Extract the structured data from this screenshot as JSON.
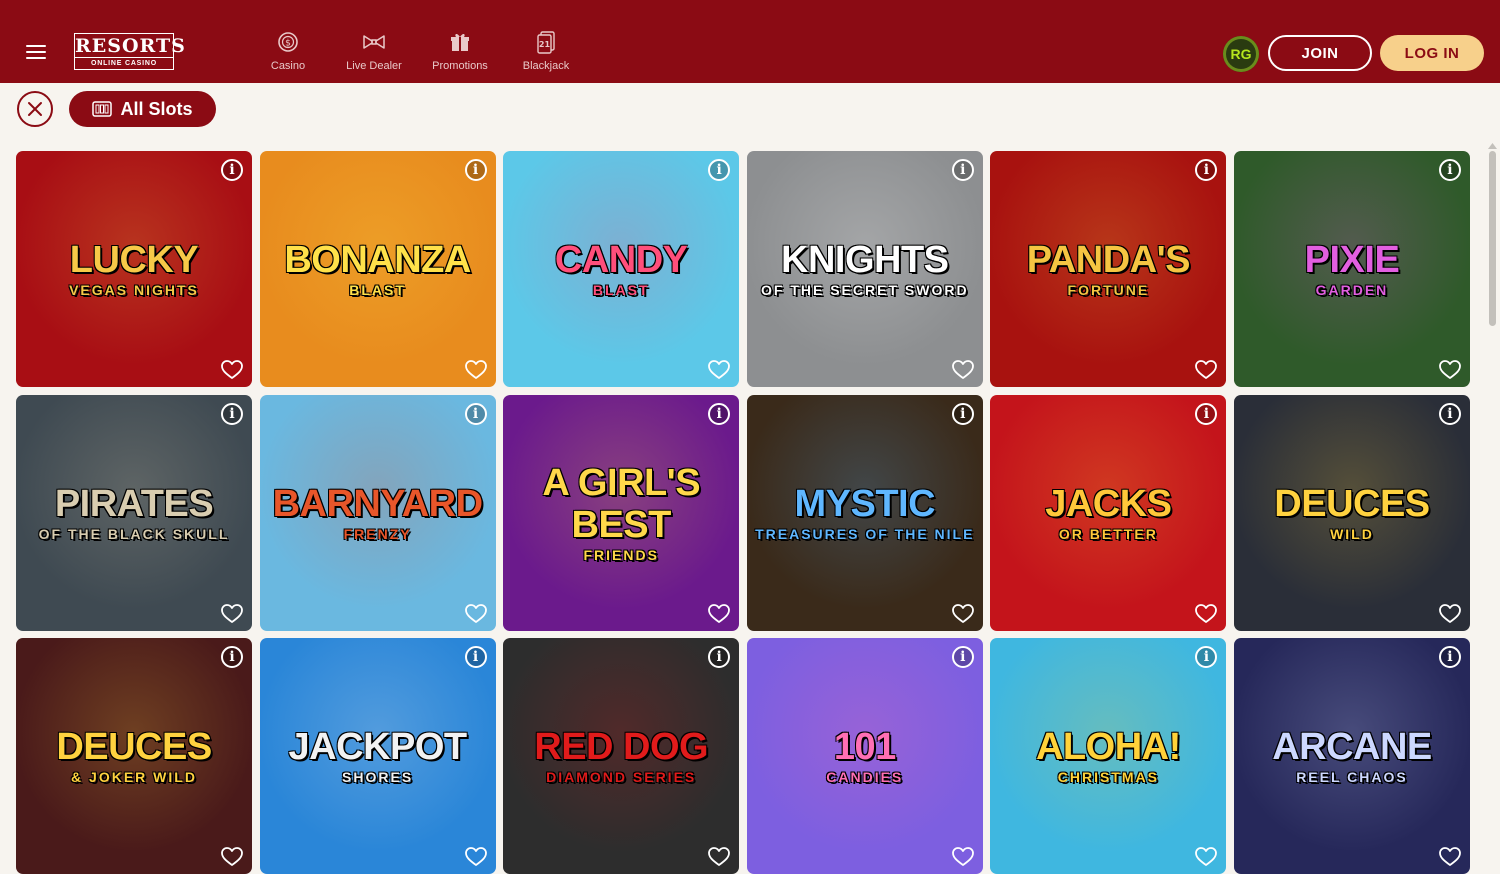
{
  "header": {
    "logo": {
      "main": "RESORTS",
      "sub": "ONLINE CASINO"
    },
    "nav": [
      {
        "label": "Casino",
        "icon": "casino-chip-icon"
      },
      {
        "label": "Live Dealer",
        "icon": "bow-tie-icon"
      },
      {
        "label": "Promotions",
        "icon": "gift-icon"
      },
      {
        "label": "Blackjack",
        "icon": "blackjack-21-icon"
      }
    ],
    "rg_badge": "RG",
    "join_label": "JOIN",
    "login_label": "LOG IN"
  },
  "filter": {
    "chip_label": "All Slots",
    "chip_icon": "slot-machine-icon",
    "close_icon": "close-icon"
  },
  "games": [
    {
      "title": "LUCKY",
      "sub": "VEGAS NIGHTS",
      "bg": "#a80e14",
      "accent": "#f7c948"
    },
    {
      "title": "BONANZA",
      "sub": "BLAST",
      "bg": "#e88c1e",
      "accent": "#ffe14a"
    },
    {
      "title": "CANDY",
      "sub": "BLAST",
      "bg": "#5cc8e8",
      "accent": "#ff4f7b"
    },
    {
      "title": "KNIGHTS",
      "sub": "OF THE SECRET SWORD",
      "bg": "#8d8f91",
      "accent": "#ffffff"
    },
    {
      "title": "PANDA'S",
      "sub": "FORTUNE",
      "bg": "#a8120f",
      "accent": "#f5c542"
    },
    {
      "title": "PIXIE",
      "sub": "GARDEN",
      "bg": "#2f5a2a",
      "accent": "#e25fe0"
    },
    {
      "title": "PIRATES",
      "sub": "OF THE BLACK SKULL",
      "bg": "#3f4a52",
      "accent": "#d9cdb0"
    },
    {
      "title": "BARNYARD",
      "sub": "FRENZY",
      "bg": "#6ab8e0",
      "accent": "#e8562a"
    },
    {
      "title": "A GIRL'S BEST",
      "sub": "FRIENDS",
      "bg": "#6b1a8c",
      "accent": "#ffd84a"
    },
    {
      "title": "MYSTIC",
      "sub": "TREASURES OF THE NILE",
      "bg": "#3a2a1a",
      "accent": "#5fb7ff"
    },
    {
      "title": "JACKS",
      "sub": "OR BETTER",
      "bg": "#c4141b",
      "accent": "#ffc83a"
    },
    {
      "title": "DEUCES",
      "sub": "WILD",
      "bg": "#2a2e38",
      "accent": "#ffd23f"
    },
    {
      "title": "DEUCES",
      "sub": "& JOKER WILD",
      "bg": "#4a1a1a",
      "accent": "#ffd23f"
    },
    {
      "title": "JACKPOT",
      "sub": "SHORES",
      "bg": "#2a86d8",
      "accent": "#f2f2f2"
    },
    {
      "title": "RED DOG",
      "sub": "DIAMOND SERIES",
      "bg": "#2d2d2d",
      "accent": "#e01b1b"
    },
    {
      "title": "101",
      "sub": "CANDIES",
      "bg": "#7d5fe0",
      "accent": "#ff6fb4"
    },
    {
      "title": "ALOHA!",
      "sub": "CHRISTMAS",
      "bg": "#3fb7e0",
      "accent": "#ffd23a"
    },
    {
      "title": "ARCANE",
      "sub": "REEL CHAOS",
      "bg": "#26285a",
      "accent": "#cdd8ff"
    }
  ]
}
